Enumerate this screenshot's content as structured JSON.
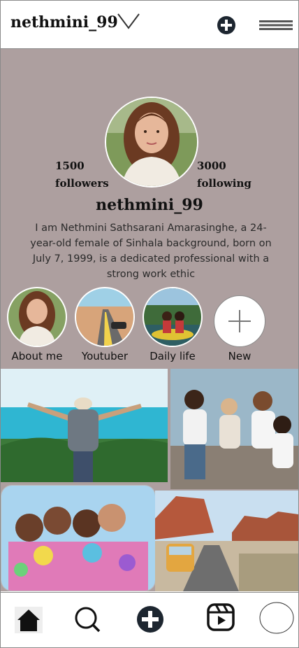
{
  "header": {
    "username": "nethmini_99",
    "icons": [
      "chevron-down-icon",
      "add-icon",
      "menu-icon"
    ]
  },
  "profile": {
    "followers_count": "1500",
    "followers_label": "followers",
    "following_count": "3000",
    "following_label": "following",
    "name": "nethmini_99",
    "bio": "I am Nethmini Sathsarani Amarasinghe, a 24-year-old female of Sinhala background, born on July 7, 1999, is a dedicated professional with a strong work ethic"
  },
  "highlights": [
    {
      "label": "About me"
    },
    {
      "label": "Youtuber"
    },
    {
      "label": "Daily life"
    },
    {
      "label": "New"
    }
  ],
  "bottom_nav": {
    "icons": [
      "home-icon",
      "search-icon",
      "add-post-icon",
      "reels-icon",
      "profile-icon"
    ]
  },
  "colors": {
    "profile_background": "#ad9f9f",
    "accent_dark": "#1d2630"
  }
}
